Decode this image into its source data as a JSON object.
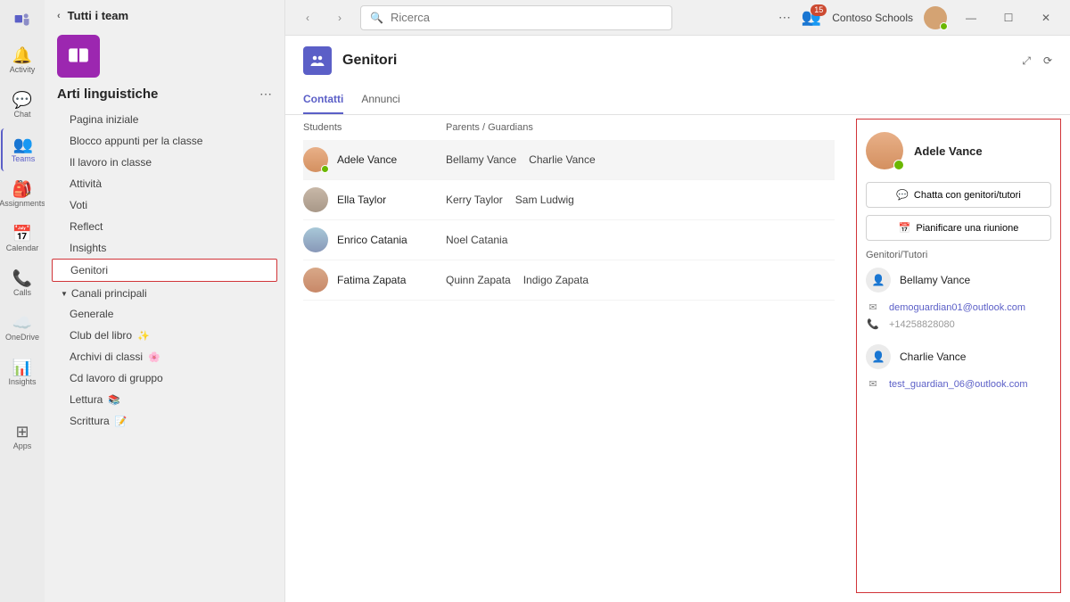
{
  "titlebar": {
    "search_placeholder": "Ricerca",
    "org_name": "Contoso Schools",
    "notif_count": "15"
  },
  "app_rail": {
    "activity": "Activity",
    "chat": "Chat",
    "teams": "Teams",
    "assignments": "Assignments",
    "calendar": "Calendar",
    "calls": "Calls",
    "onedrive": "OneDrive",
    "insights": "Insights",
    "apps": "Apps"
  },
  "nav": {
    "back_label": "Tutti i team",
    "team_name": "Arti linguistiche",
    "items": {
      "home": "Pagina iniziale",
      "notebook": "Blocco appunti per la classe",
      "classwork": "Il lavoro in classe",
      "activity": "Attività",
      "grades": "Voti",
      "reflect": "Reflect",
      "insights": "Insights",
      "parents": "Genitori"
    },
    "section_label": "Canali principali",
    "channels": {
      "general": "Generale",
      "bookclub": "Club del libro",
      "archives": "Archivi di classi",
      "groupwork": "Cd lavoro di gruppo",
      "reading": "Lettura",
      "writing": "Scrittura"
    }
  },
  "page": {
    "title": "Genitori",
    "tab_contacts": "Contatti",
    "tab_announcements": "Annunci"
  },
  "table": {
    "col_students": "Students",
    "col_guardians": "Parents / Guardians",
    "rows": [
      {
        "student": "Adele Vance",
        "guardians": [
          "Bellamy Vance",
          "Charlie Vance"
        ]
      },
      {
        "student": "Ella Taylor",
        "guardians": [
          "Kerry Taylor",
          "Sam Ludwig"
        ]
      },
      {
        "student": "Enrico Catania",
        "guardians": [
          "Noel Catania"
        ]
      },
      {
        "student": "Fatima Zapata",
        "guardians": [
          "Quinn Zapata",
          "Indigo Zapata"
        ]
      }
    ]
  },
  "detail": {
    "student_name": "Adele Vance",
    "chat_btn": "Chatta con genitori/tutori",
    "schedule_btn": "Pianificare una riunione",
    "section_label": "Genitori/Tutori",
    "guardians": [
      {
        "name": "Bellamy Vance",
        "email": "demoguardian01@outlook.com",
        "phone": "+14258828080"
      },
      {
        "name": "Charlie Vance",
        "email": "test_guardian_06@outlook.com"
      }
    ]
  }
}
